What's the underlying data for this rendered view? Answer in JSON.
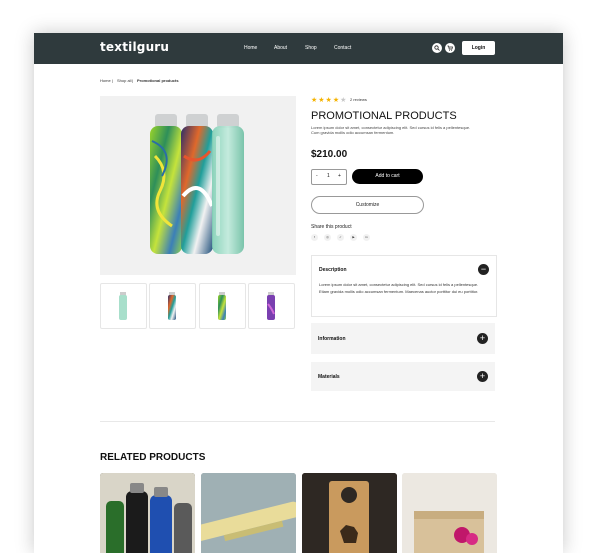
{
  "nav": {
    "logo": "textilguru",
    "menu": [
      "Home",
      "About",
      "Shop",
      "Contact"
    ],
    "search_icon": "search-icon",
    "cart_icon": "cart-icon",
    "login_label": "Login"
  },
  "breadcrumb": {
    "home": "Home",
    "shop": "Shop all",
    "current": "Promotional products"
  },
  "product": {
    "rating": 4,
    "rating_max": 5,
    "stars_filled": "★★★★",
    "stars_empty": "★",
    "reviews": "2 reviews",
    "title": "PROMOTIONAL PRODUCTS",
    "description": "Lorem ipsum dolor sit amet, consectetur adipiscing elit. Sed cursus id felis a pellentesque. Cum gravida mollis odio accumsan fermentum.",
    "price": "$210.00",
    "quantity": "1",
    "qty_minus": "-",
    "qty_plus": "+",
    "add_to_cart": "Add to cart",
    "customize": "Customize",
    "share_label": "Share this product",
    "share_icons": [
      "f",
      "◎",
      "✓",
      "▶",
      "in"
    ]
  },
  "accordion": {
    "description_title": "Description",
    "description_text": "Lorem ipsum dolor sit amet, consectetur adipiscing elit. Sed cursus id felis a pellentesque. Etiam gravida mollis odio accumsan fermentum. Maecenas auctor porttitor dui eu porttitor.",
    "information_title": "Information",
    "materials_title": "Materials",
    "minus": "−",
    "plus": "+"
  },
  "related": {
    "title": "RELATED PRODUCTS"
  },
  "colors": {
    "nav_bg": "#2f3a3d",
    "star_filled": "#f5b301",
    "star_empty": "#c8c8c8"
  }
}
